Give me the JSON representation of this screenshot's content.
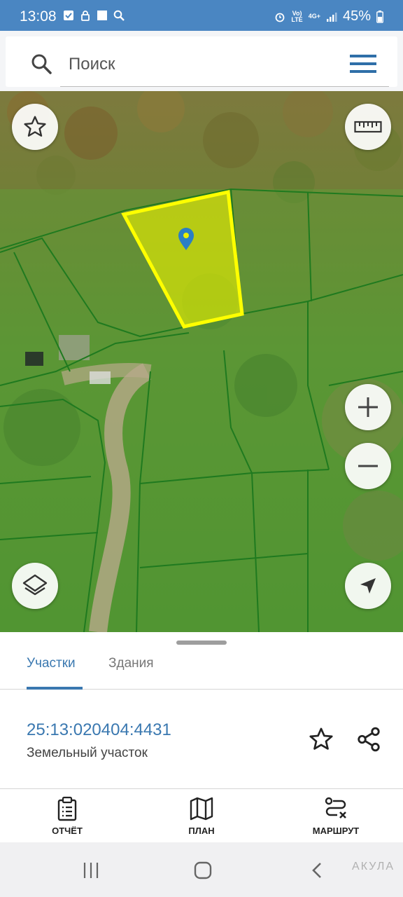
{
  "status_bar": {
    "time": "13:08",
    "network_top": "Vo)",
    "network_bottom": "LTE",
    "signal_type": "4G+",
    "battery": "45%",
    "icons": [
      "checkbox-icon",
      "lock-icon",
      "square-icon",
      "search-icon",
      "alarm-icon",
      "signal-icon",
      "battery-icon"
    ]
  },
  "search": {
    "placeholder": "Поиск",
    "icons": [
      "search-icon",
      "menu-icon"
    ]
  },
  "map": {
    "controls": [
      "favorite-star-icon",
      "ruler-icon",
      "zoom-in-icon",
      "zoom-out-icon",
      "layers-icon",
      "location-arrow-icon"
    ],
    "selected_parcel_color": "#ffff00",
    "parcel_border_color": "#1f7a1f",
    "marker_color": "#2a7fc4"
  },
  "sheet": {
    "tabs": [
      {
        "label": "Участки",
        "active": true
      },
      {
        "label": "Здания",
        "active": false
      }
    ],
    "parcel": {
      "number": "25:13:020404:4431",
      "type": "Земельный участок"
    },
    "actions": [
      {
        "label": "ОТЧЁТ",
        "icon": "report-clipboard-icon"
      },
      {
        "label": "ПЛАН",
        "icon": "map-plan-icon"
      },
      {
        "label": "МАРШРУТ",
        "icon": "route-icon"
      }
    ]
  },
  "navbar": {
    "watermark": "АКУЛА",
    "buttons": [
      "recent-apps-icon",
      "home-icon",
      "back-icon"
    ]
  },
  "colors": {
    "accent": "#3a78b0",
    "status_bar": "#4a86c2"
  }
}
